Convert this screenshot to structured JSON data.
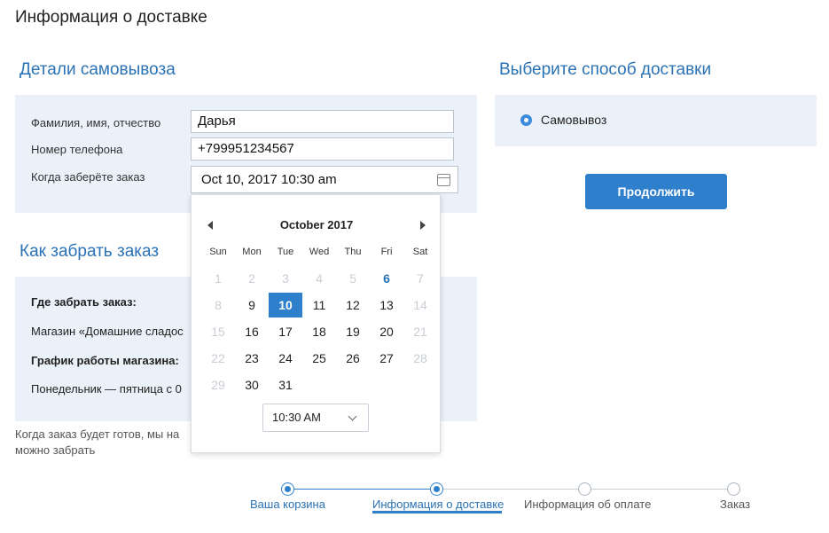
{
  "page_title": "Информация о доставке",
  "pickup": {
    "title": "Детали самовывоза",
    "fields": {
      "name_label": "Фамилия, имя, отчество",
      "name_value": "Дарья",
      "phone_label": "Номер телефона",
      "phone_value": "+799951234567",
      "date_label": "Когда заберёте заказ",
      "date_value": "Oct 10, 2017 10:30 am"
    }
  },
  "delivery": {
    "title": "Выберите способ доставки",
    "option_label": "Самовывоз",
    "continue_label": "Продолжить"
  },
  "howto": {
    "title": "Как забрать заказ",
    "where_label": "Где забрать заказ:",
    "where_value": "Магазин «Домашние сладос",
    "schedule_label": "График работы магазина:",
    "schedule_value": "Понедельник — пятница с 0",
    "note_line1": "Когда заказ будет готов, мы на",
    "note_line2": "можно забрать"
  },
  "calendar": {
    "month_label": "October  2017",
    "weekdays": [
      "Sun",
      "Mon",
      "Tue",
      "Wed",
      "Thu",
      "Fri",
      "Sat"
    ],
    "weeks": [
      [
        "1",
        "2",
        "3",
        "4",
        "5",
        "6",
        "7"
      ],
      [
        "8",
        "9",
        "10",
        "11",
        "12",
        "13",
        "14"
      ],
      [
        "15",
        "16",
        "17",
        "18",
        "19",
        "20",
        "21"
      ],
      [
        "22",
        "23",
        "24",
        "25",
        "26",
        "27",
        "28"
      ],
      [
        "29",
        "30",
        "31"
      ]
    ],
    "selected_day": "10",
    "today_day": "6",
    "time_value": "10:30 AM"
  },
  "steps": [
    {
      "label": "Ваша корзина",
      "state": "done"
    },
    {
      "label": "Информация о доставке",
      "state": "current"
    },
    {
      "label": "Информация об оплате",
      "state": "todo"
    },
    {
      "label": "Заказ",
      "state": "todo"
    }
  ],
  "colors": {
    "accent": "#2f80cc",
    "panel_bg": "#eaf1f9",
    "title_blue": "#2a72b5",
    "muted_day": "#c9ced4"
  }
}
